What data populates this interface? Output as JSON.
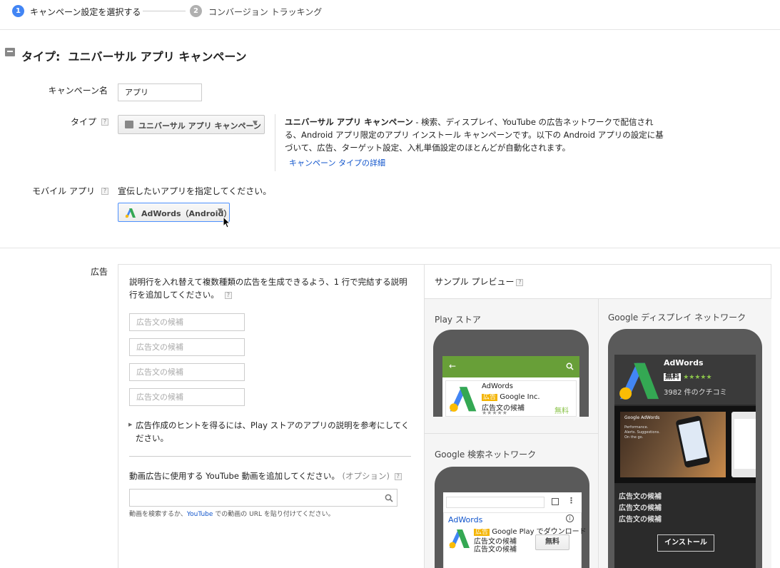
{
  "steps": [
    {
      "num": "1",
      "label": "キャンペーン設定を選択する"
    },
    {
      "num": "2",
      "label": "コンバージョン トラッキング"
    }
  ],
  "section_title": "タイプ:  ユニバーサル アプリ キャンペーン",
  "form": {
    "campaign_name_label": "キャンペーン名",
    "campaign_name_value": "アプリ",
    "type_label": "タイプ",
    "type_dropdown": "ユニバーサル アプリ キャンペーン",
    "type_desc_bold": "ユニバーサル アプリ キャンペーン",
    "type_desc_line1": " - 検索、ディスプレイ、YouTube の広告ネットワークで配信され",
    "type_desc_line2": "る、Android アプリ限定のアプリ インストール キャンペーンです。以下の Android アプリの設定に基",
    "type_desc_line3": "づいて、広告、ターゲット設定、入札単価設定のほとんどが自動化されます。",
    "type_desc_link": "キャンペーン タイプの詳細",
    "mobile_app_label": "モバイル アプリ",
    "mobile_app_hint": "宣伝したいアプリを指定してください。",
    "mobile_app_dropdown": "AdWords（Android）",
    "ad_label": "広告"
  },
  "ad_panel": {
    "intro_line1": "説明行を入れ替えて複数種類の広告を生成できるよう、1 行で完結する説明",
    "intro_line2": "行を追加してください。",
    "inputs": [
      "広告文の候補",
      "広告文の候補",
      "広告文の候補",
      "広告文の候補"
    ],
    "hint_line1": "広告作成のヒントを得るには、Play ストアのアプリの説明を参考にしてく",
    "hint_line2": "ださい。",
    "video_label": "動画広告に使用する YouTube 動画を追加してください。",
    "video_optional": "(オプション)",
    "video_help_pre": "動画を検索するか、",
    "video_help_link": "YouTube",
    "video_help_post": " での動画の URL を貼り付けてください。"
  },
  "preview": {
    "title": "サンプル プレビュー",
    "play_store": {
      "title": "Play ストア",
      "app_name": "AdWords",
      "ad_badge": "広告",
      "developer": "Google Inc.",
      "candidate": "広告文の候補",
      "free": "無料",
      "stars": "★★★★★"
    },
    "search": {
      "title": "Google 検索ネットワーク",
      "app_name": "AdWords",
      "ad_badge": "広告",
      "play_text": "Google Play でダウンロード",
      "candidate1": "広告文の候補",
      "candidate2": "広告文の候補",
      "free_button": "無料"
    },
    "display": {
      "title": "Google ディスプレイ ネットワーク",
      "app_name": "AdWords",
      "free": "無料",
      "stars": "★★★★★",
      "reviews": "3982 件のクチコミ",
      "banner_brand": "Google AdWords",
      "banner_line1": "Performance.",
      "banner_line2": "Alerts. Suggestions.",
      "banner_line3": "On the go.",
      "candidate1": "広告文の候補",
      "candidate2": "広告文の候補",
      "candidate3": "広告文の候補",
      "install": "インストール"
    }
  },
  "colors": {
    "step_active": "#4285f4",
    "step_inactive": "#b0b0b0",
    "link": "#1155cc",
    "play_green": "#689f38",
    "ad_badge": "#f4b400",
    "free_green": "#8bc34a"
  }
}
